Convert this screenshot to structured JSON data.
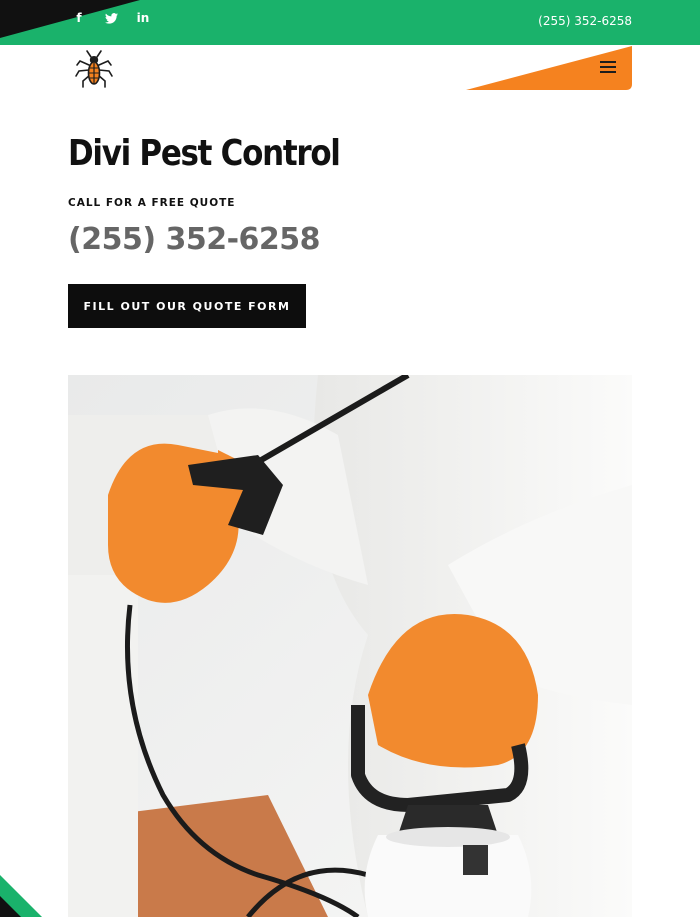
{
  "topbar": {
    "phone": "(255) 352-6258",
    "social": [
      {
        "icon": "facebook-icon",
        "glyph": "f"
      },
      {
        "icon": "twitter-icon",
        "glyph": ""
      },
      {
        "icon": "linkedin-icon",
        "glyph": "in"
      }
    ]
  },
  "hero": {
    "title": "Divi Pest Control",
    "kicker": "CALL FOR A FREE QUOTE",
    "phone": "(255) 352-6258",
    "cta_label": "FILL OUT OUR QUOTE FORM"
  },
  "colors": {
    "green": "#1ab26b",
    "orange": "#f5821f",
    "black": "#111111",
    "phone_gray": "#666666"
  }
}
